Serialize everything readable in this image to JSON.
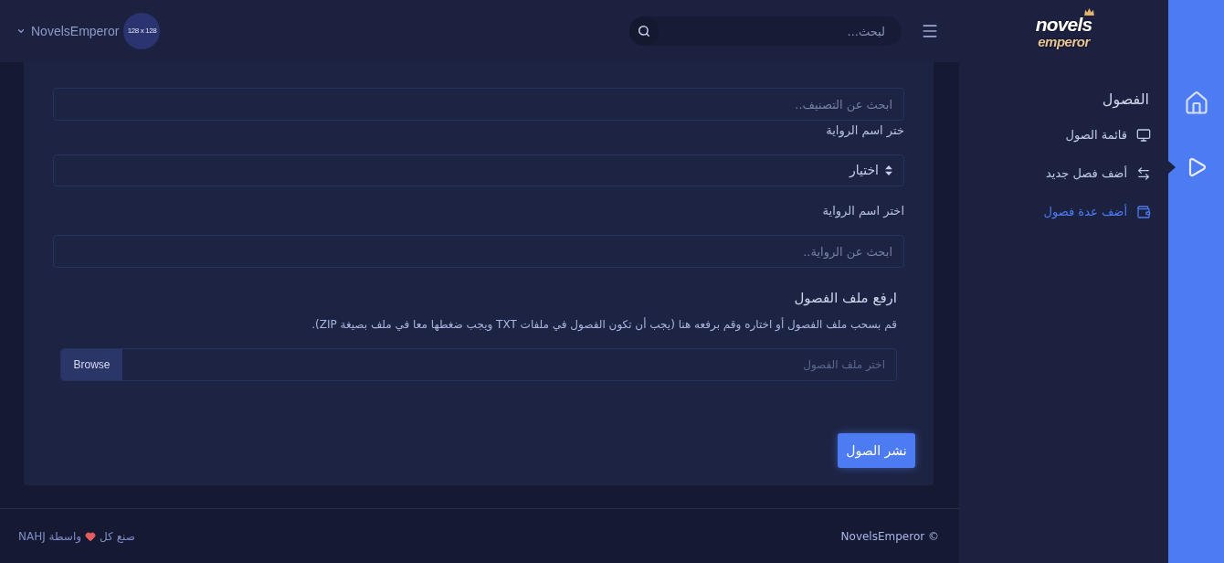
{
  "rail": {
    "items": [
      {
        "kind": "home",
        "selected": false
      },
      {
        "kind": "play",
        "selected": true
      }
    ]
  },
  "sidebar": {
    "logo": {
      "title": "novels",
      "subtitle": "emperor"
    },
    "heading": "الفصول",
    "items": [
      {
        "kind": "monitor",
        "label": "قائمة الصول",
        "selected": false
      },
      {
        "kind": "arrows",
        "label": "أضف فصل جديد",
        "selected": false
      },
      {
        "kind": "wallet",
        "label": "أضف عدة فصول",
        "selected": true
      }
    ]
  },
  "header": {
    "search": {
      "placeholder": "لبحث..."
    },
    "user": {
      "avatar_text": "128 x 128",
      "name": "NovelsEmperor"
    }
  },
  "form": {
    "category_search": {
      "placeholder": "ابحث عن التصنيف.."
    },
    "novel_select": {
      "label": "ختر اسم الرواية",
      "value": "اختيار"
    },
    "novel_search": {
      "label": "اختر اسم الرواية",
      "placeholder": "ابحث عن الرواية.."
    },
    "upload": {
      "title": "ارفع ملف الفصول",
      "description": "قم بسحب ملف الفصول أو اختاره وقم برفعه هنا (يجب أن تكون الفصول في ملفات TXT ويجب ضغطها معا في ملف بصيغة ZIP).",
      "file_placeholder": "اختر ملف الفصول",
      "browse_button": "Browse"
    },
    "submit_button": "نشر الصول"
  },
  "footer": {
    "copyright": "© NovelsEmperor",
    "credit_before": "صنع كل",
    "credit_after": "واسطة NAHJ"
  }
}
